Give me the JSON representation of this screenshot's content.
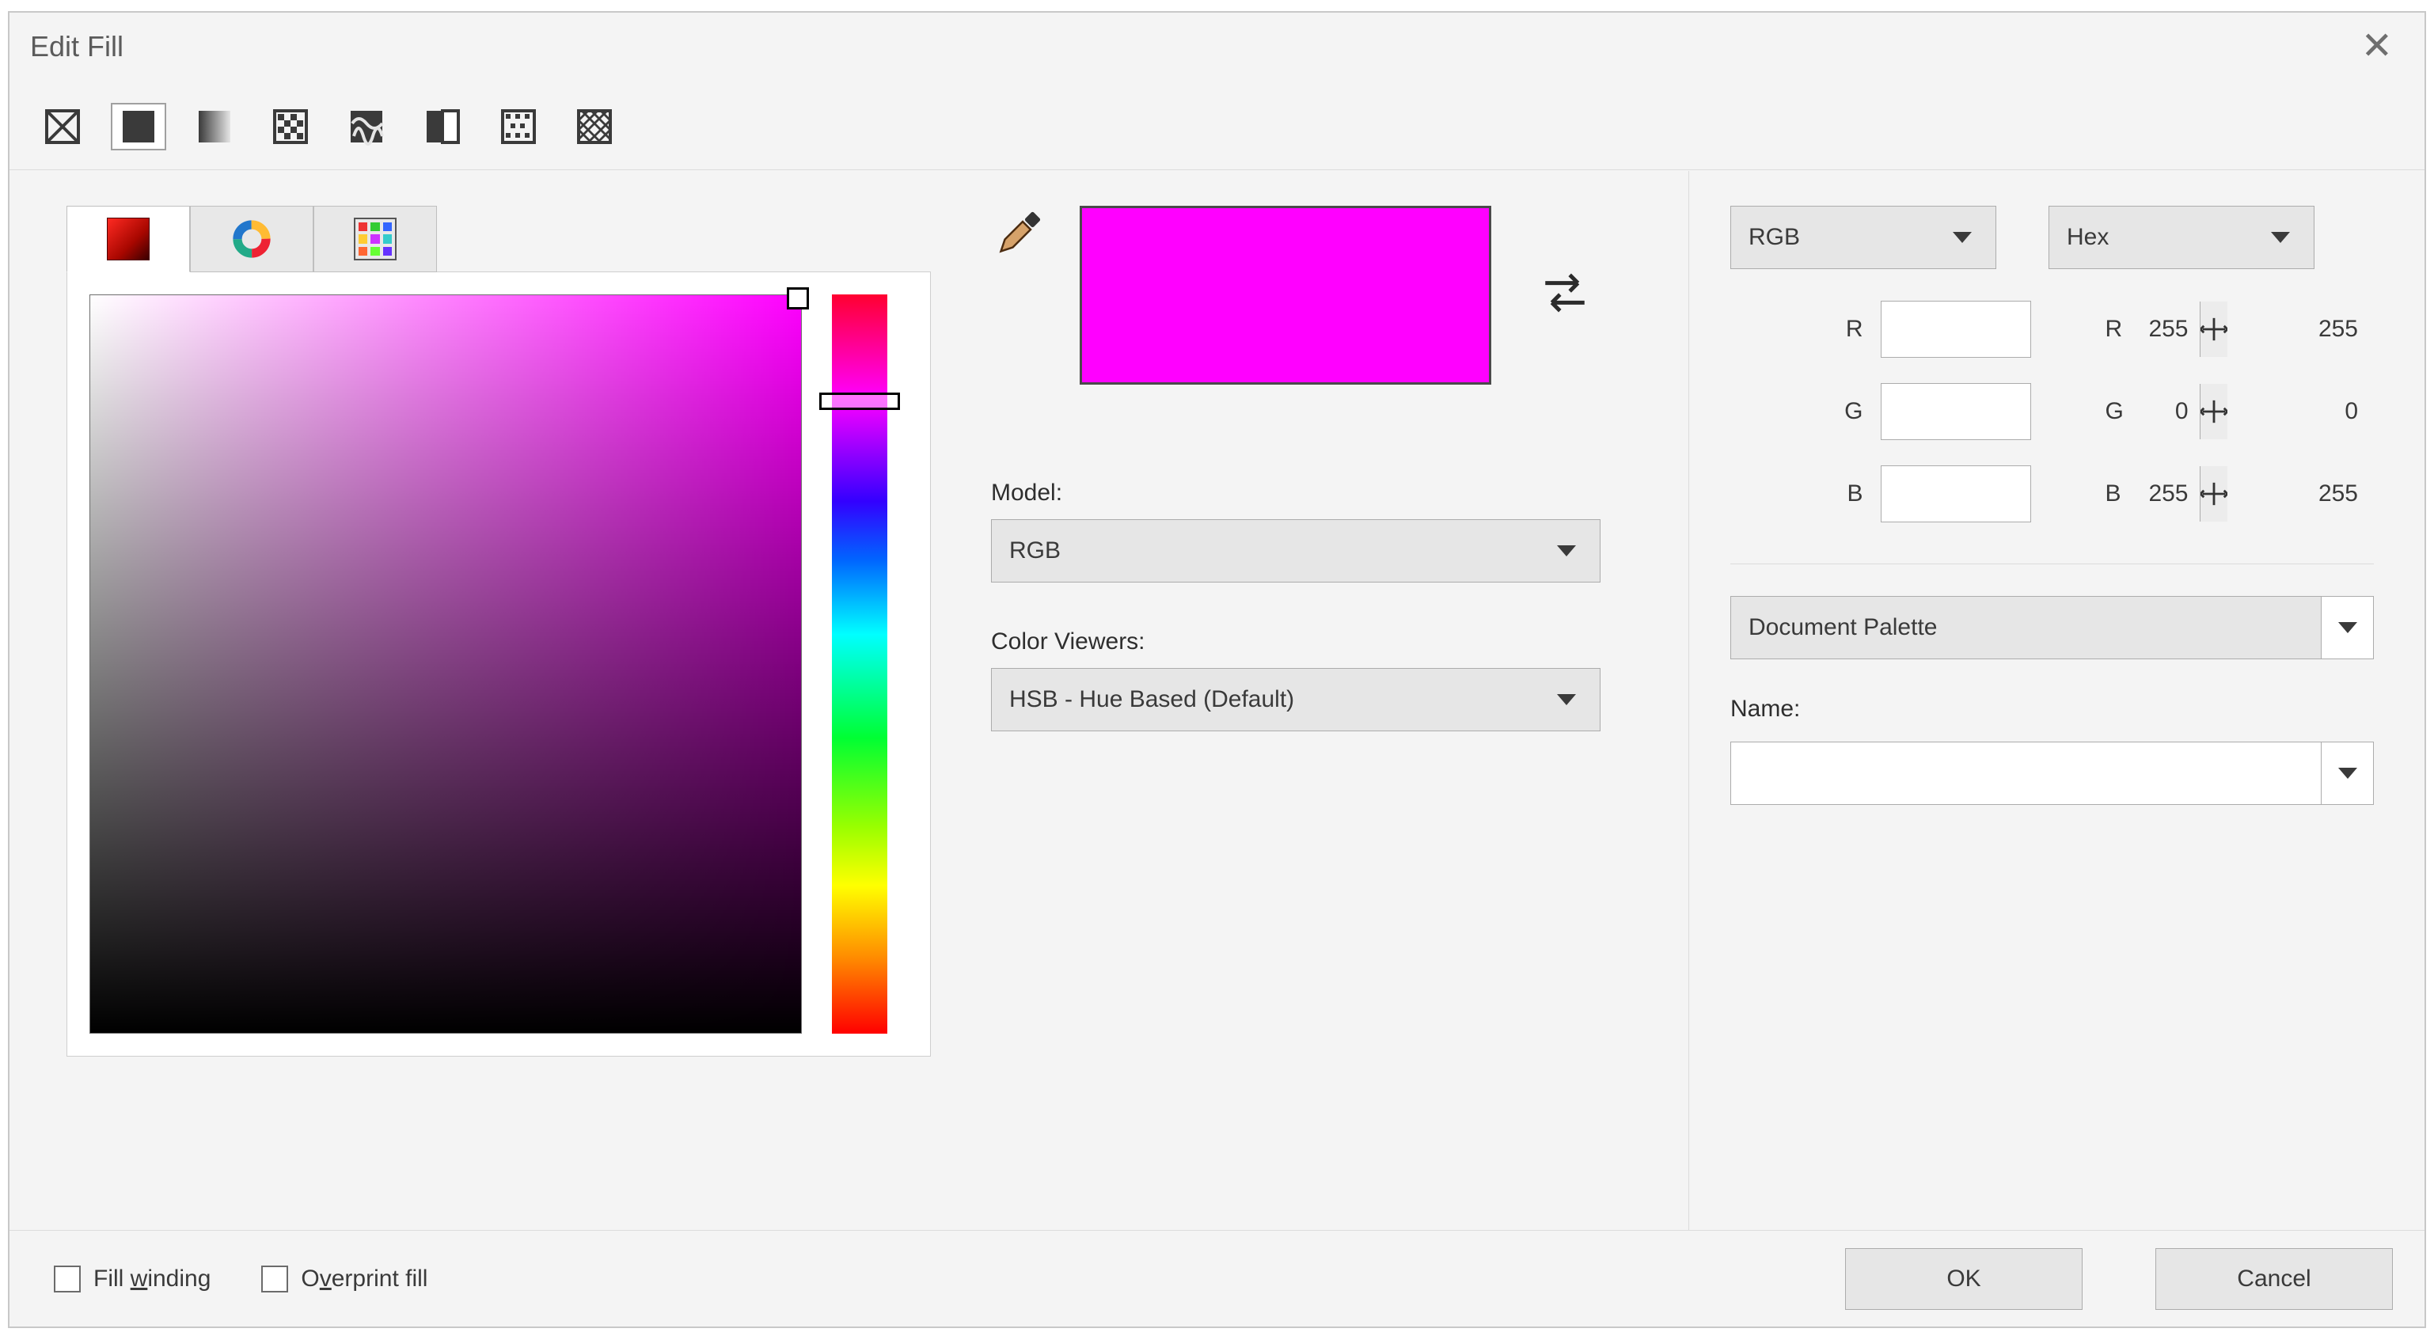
{
  "dialog": {
    "title": "Edit Fill"
  },
  "toolbar": [
    {
      "name": "fill-none-icon",
      "selected": false
    },
    {
      "name": "fill-solid-icon",
      "selected": true
    },
    {
      "name": "fill-fountain-icon",
      "selected": false
    },
    {
      "name": "fill-pattern-icon",
      "selected": false
    },
    {
      "name": "fill-texture-icon",
      "selected": false
    },
    {
      "name": "fill-twocolor-icon",
      "selected": false
    },
    {
      "name": "fill-bitmap-icon",
      "selected": false
    },
    {
      "name": "fill-postscript-icon",
      "selected": false
    }
  ],
  "mid": {
    "model_label": "Model:",
    "model_value": "RGB",
    "viewers_label": "Color Viewers:",
    "viewers_value": "HSB - Hue Based (Default)"
  },
  "right": {
    "model1_value": "RGB",
    "model2_value": "Hex",
    "rows": [
      {
        "label": "R",
        "value": "255",
        "ro": "255"
      },
      {
        "label": "G",
        "value": "0",
        "ro": "0"
      },
      {
        "label": "B",
        "value": "255",
        "ro": "255"
      }
    ],
    "palette_label": "Document Palette",
    "name_label": "Name:",
    "name_value": ""
  },
  "preview_hex": "#ff00ff",
  "footer": {
    "fill_winding": "Fill winding",
    "overprint": "Overprint fill",
    "ok": "OK",
    "cancel": "Cancel"
  }
}
